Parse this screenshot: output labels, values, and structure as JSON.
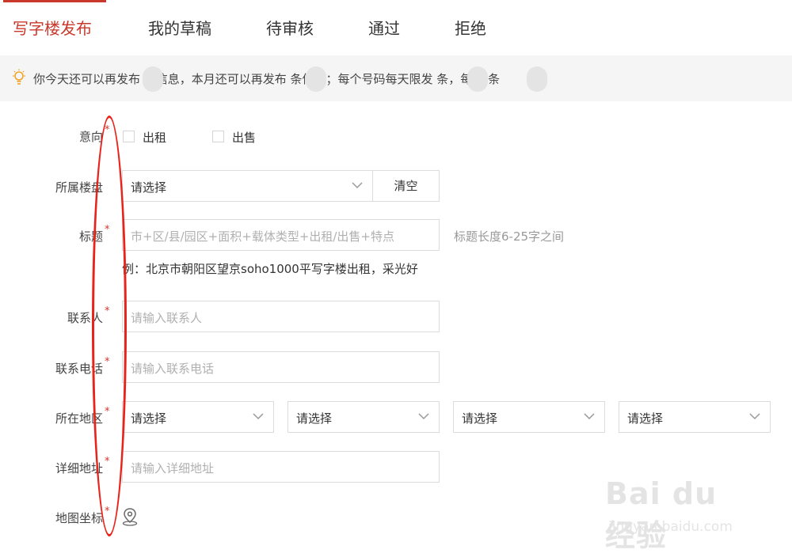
{
  "tabs": [
    {
      "label": "写字楼发布",
      "active": true
    },
    {
      "label": "我的草稿",
      "active": false
    },
    {
      "label": "待审核",
      "active": false
    },
    {
      "label": "通过",
      "active": false
    },
    {
      "label": "拒绝",
      "active": false
    }
  ],
  "notice": {
    "icon": "lightbulb-icon",
    "text": "你今天还可以再发布 条信息，本月还可以再发布 条信息；每个号码每天限发 条，每月 条"
  },
  "form": {
    "intent": {
      "label": "意向",
      "required_mark": "*",
      "options": [
        "出租",
        "出售"
      ]
    },
    "building": {
      "label": "所属楼盘",
      "required_mark": "",
      "select_value": "请选择",
      "clear_label": "清空"
    },
    "title": {
      "label": "标题",
      "required_mark": "*",
      "placeholder": "市+区/县/园区+面积+载体类型+出租/出售+特点",
      "hint": "标题长度6-25字之间",
      "example": "例：北京市朝阳区望京soho1000平写字楼出租，采光好"
    },
    "contact": {
      "label": "联系人",
      "required_mark": "*",
      "placeholder": "请输入联系人"
    },
    "phone": {
      "label": "联系电话",
      "required_mark": "*",
      "placeholder": "请输入联系电话"
    },
    "region": {
      "label": "所在地区",
      "required_mark": "*",
      "selects": [
        "请选择",
        "请选择",
        "请选择",
        "请选择"
      ]
    },
    "address": {
      "label": "详细地址",
      "required_mark": "*",
      "placeholder": "请输入详细地址"
    },
    "map": {
      "label": "地图坐标",
      "required_mark": "*",
      "icon": "map-pin-icon"
    }
  },
  "watermark": {
    "logo": "Bai du 经验",
    "sub": "jingyan.baidu.com"
  },
  "colors": {
    "accent": "#c8392b",
    "required": "#d9362b",
    "annotation": "#e8231a"
  }
}
